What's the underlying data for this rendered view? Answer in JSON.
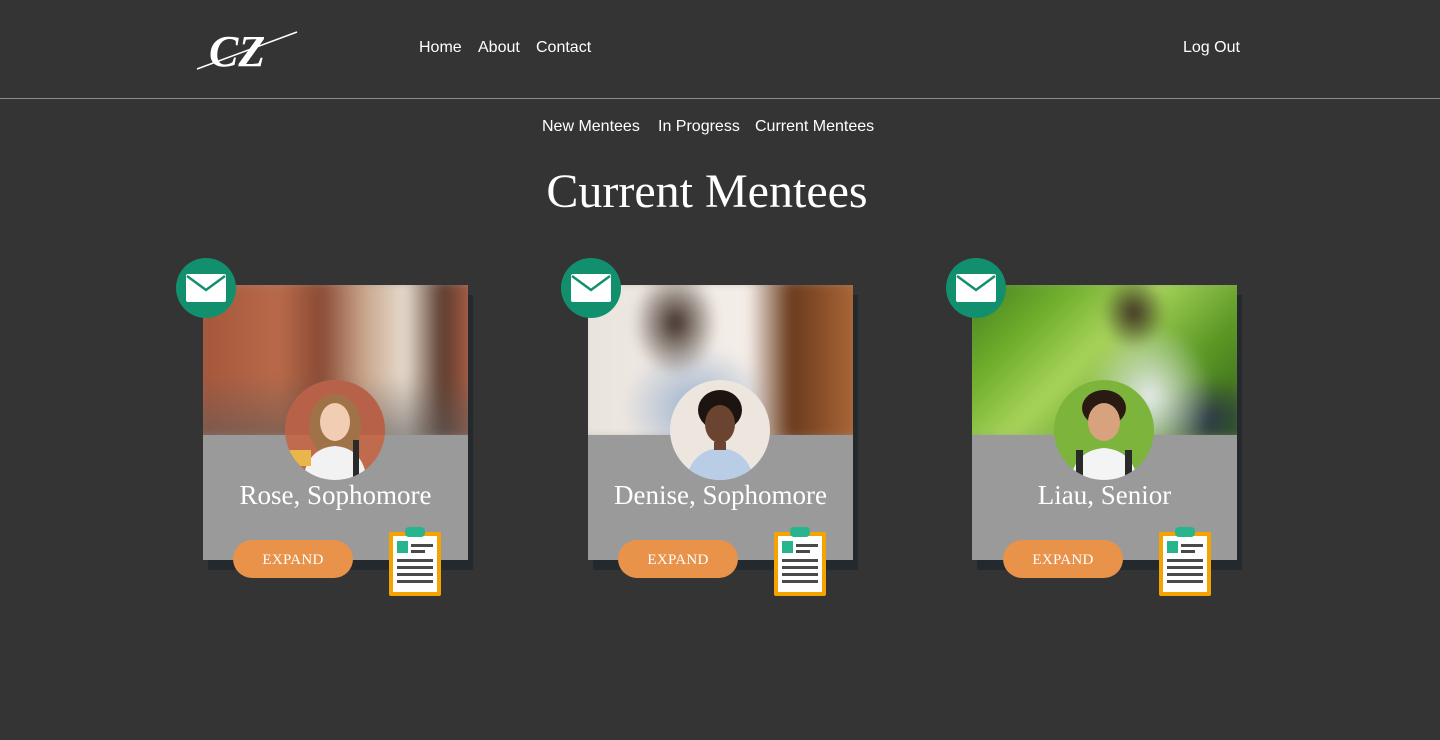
{
  "header": {
    "logo_text": "CZ",
    "nav": [
      {
        "label": "Home"
      },
      {
        "label": "About"
      },
      {
        "label": "Contact"
      }
    ],
    "logout_label": "Log Out"
  },
  "subnav": [
    {
      "label": "New Mentees"
    },
    {
      "label": "In Progress"
    },
    {
      "label": "Current Mentees"
    }
  ],
  "page_title": "Current Mentees",
  "cards": [
    {
      "name": "Rose, Sophomore",
      "expand_label": "EXPAND"
    },
    {
      "name": "Denise, Sophomore",
      "expand_label": "EXPAND"
    },
    {
      "name": "Liau, Senior",
      "expand_label": "EXPAND"
    }
  ],
  "icons": {
    "mail": "envelope-icon",
    "profile": "clipboard-icon"
  },
  "colors": {
    "background": "#343434",
    "mail_badge": "#12906d",
    "expand_button": "#e8924a",
    "card_body": "#9a9a9a",
    "clipboard_frame": "#f4a300",
    "clipboard_accent": "#28b48c"
  }
}
